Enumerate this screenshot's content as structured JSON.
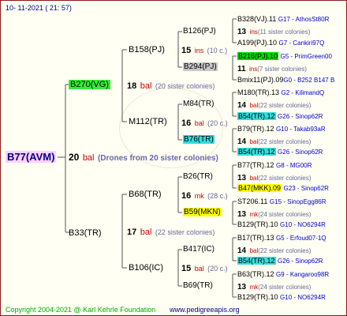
{
  "date": "10- 11-2021 ( 21: 57)",
  "root": {
    "name": "B77(AVM)",
    "count": "20",
    "unit": "bal",
    "note": "(Drones from 20 sister colonies)"
  },
  "sire": {
    "name": "B270(VG)",
    "count": "18",
    "unit": "bal",
    "note": "(20 sister colonies)"
  },
  "dam": {
    "name": "B33(TR)",
    "count": "17",
    "unit": "bal",
    "note": "(22 sister colonies)"
  },
  "g2": [
    {
      "name": "B158(PJ)",
      "count": "15",
      "unit": "ins",
      "note": "(10 c.)"
    },
    {
      "name": "M112(TR)",
      "count": "16",
      "unit": "bal",
      "note": "(20 c.)"
    },
    {
      "name": "B68(TR)",
      "count": "16",
      "unit": "mk",
      "note": "(28 c.)"
    },
    {
      "name": "B106(IC)",
      "count": "15",
      "unit": "bal",
      "note": "(20 c.)"
    }
  ],
  "g3": [
    "B126(PJ)",
    "B294(PJ)",
    "M84(TR)",
    "B76(TR)",
    "B26(TR)",
    "B59(MKN)",
    "B417(IC)",
    "B69(TR)"
  ],
  "g4": [
    {
      "name": "B328(VJ).11",
      "extra": "G17 - AthosSt80R"
    },
    {
      "count": "13",
      "unit": "ins",
      "note": "(11 sister colonies)"
    },
    {
      "name": "A199(PJ).10",
      "extra": "G7 - Cankiri97Q"
    },
    {
      "name": "B216(PJ).10",
      "extra": "G5 - PrimGreen00"
    },
    {
      "count": "11",
      "unit": "ins",
      "note": "(7 sister colonies)"
    },
    {
      "name": "Bmix11(PJ).09",
      "extra": "G0 - B252 B147 B"
    },
    {
      "name": "M180(TR).13",
      "extra": "G2 - KilimandQ"
    },
    {
      "count": "14",
      "unit": "bal",
      "note": "(22 sister colonies)"
    },
    {
      "name": "B54(TR).12",
      "extra": "G26 - Sinop62R"
    },
    {
      "name": "B79(TR).12",
      "extra": "G10 - Takab93aR"
    },
    {
      "count": "14",
      "unit": "bal",
      "note": "(22 sister colonies)"
    },
    {
      "name": "B54(TR).12",
      "extra": "G26 - Sinop62R"
    },
    {
      "name": "B77(TR).12",
      "extra": "G8 - MG00R"
    },
    {
      "count": "13",
      "unit": "bal",
      "note": "(22 sister colonies)"
    },
    {
      "name": "B47(MKK).09",
      "extra": "G23 - Sinop62R"
    },
    {
      "name": "ST206.11",
      "extra": "G15 - SinopEgg86R"
    },
    {
      "count": "13",
      "unit": "mk",
      "note": "(24 sister colonies)"
    },
    {
      "name": "B129(TR).10",
      "extra": "G10 - NO6294R"
    },
    {
      "name": "B17(TR).13",
      "extra": "G5 - Erfoud07-1Q"
    },
    {
      "count": "14",
      "unit": "bal",
      "note": "(22 sister colonies)"
    },
    {
      "name": "B54(TR).12",
      "extra": "G26 - Sinop62R"
    },
    {
      "name": "B63(TR).12",
      "extra": "G9 - Kangaroo98R"
    },
    {
      "count": "13",
      "unit": "mk",
      "note": "(24 sister colonies)"
    },
    {
      "name": "B129(TR).10",
      "extra": "G10 - NO6294R"
    }
  ],
  "footer": {
    "copyright": "Copyright 2004-2021 @ Karl Kehrle Foundation",
    "url": "www.pedigreeapis.org"
  },
  "colors": {
    "line": "#555555",
    "text": "#000080",
    "red": "#cc0000",
    "green": "#33ee33",
    "cyan": "#33dddd",
    "yellow": "#ffff00",
    "footer_green": "#00aa00"
  }
}
